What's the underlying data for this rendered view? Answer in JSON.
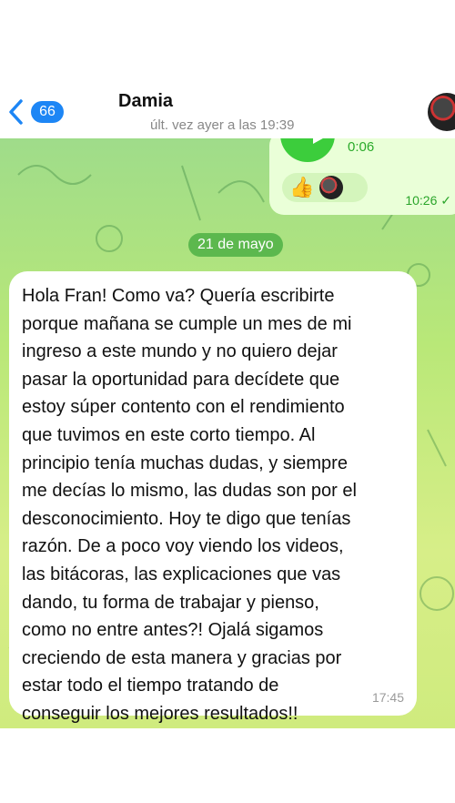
{
  "header": {
    "back_count": "66",
    "contact_name": "Damia",
    "status": "últ. vez ayer a las 19:39"
  },
  "voice_message": {
    "duration": "0:06",
    "reaction": "👍",
    "time": "10:26 ✓"
  },
  "date_chip": "21 de mayo",
  "message": {
    "lines": [
      "Hola Fran! Como va? Quería escribirte",
      "porque mañana se cumple un mes de mi",
      "ingreso a este mundo y no quiero dejar",
      "pasar la oportunidad para decídete que",
      "estoy súper contento con el rendimiento",
      "que tuvimos en este corto tiempo. Al",
      "principio tenía muchas dudas, y siempre",
      "me decías lo mismo, las dudas son por el",
      "desconocimiento. Hoy te digo que tenías",
      "razón. De a poco voy viendo los videos,",
      "las bitácoras, las explicaciones que vas",
      "dando, tu forma de  trabajar y pienso,",
      "como no entre antes?! Ojalá sigamos",
      "creciendo de esta manera y gracias por",
      "estar todo el tiempo tratando de",
      "conseguir los mejores resultados!!"
    ],
    "time": "17:45"
  },
  "colors": {
    "accent": "#1d86f5",
    "play": "#3ccd3c",
    "date_chip": "#5cb84e"
  }
}
